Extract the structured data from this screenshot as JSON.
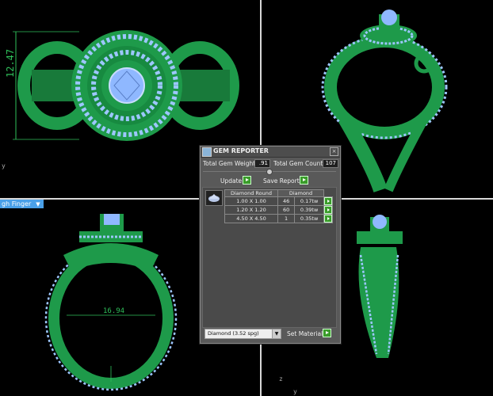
{
  "viewports": {
    "top_left": {
      "dimension_label": "12.47",
      "axis_label": "y"
    },
    "top_right": {},
    "bottom_left": {
      "view_tag": "gh Finger",
      "dimension_label": "16.94"
    },
    "bottom_right": {
      "axis_z": "z",
      "axis_y": "y"
    }
  },
  "gem_reporter": {
    "title": "GEM REPORTER",
    "total_gem_weight_label": "Total Gem Weight",
    "total_gem_weight_value": ".91",
    "total_gem_count_label": "Total Gem Count",
    "total_gem_count_value": "107",
    "update_label": "Update",
    "save_report_label": "Save Report",
    "table": {
      "headers": [
        "Diamond Round",
        "Diamond"
      ],
      "rows": [
        {
          "size": "1.00 X 1.00",
          "count": "46",
          "weight": "0.17tw"
        },
        {
          "size": "1.20 X 1.20",
          "count": "60",
          "weight": "0.39tw"
        },
        {
          "size": "4.50 X 4.50",
          "count": "1",
          "weight": "0.35tw"
        }
      ]
    },
    "material_select": "Diamond (3.52 spg)",
    "set_material_label": "Set Material"
  },
  "colors": {
    "metal": "#1e9a4a",
    "gem": "#8fb8ff",
    "background": "#000000",
    "panel": "#595959"
  }
}
